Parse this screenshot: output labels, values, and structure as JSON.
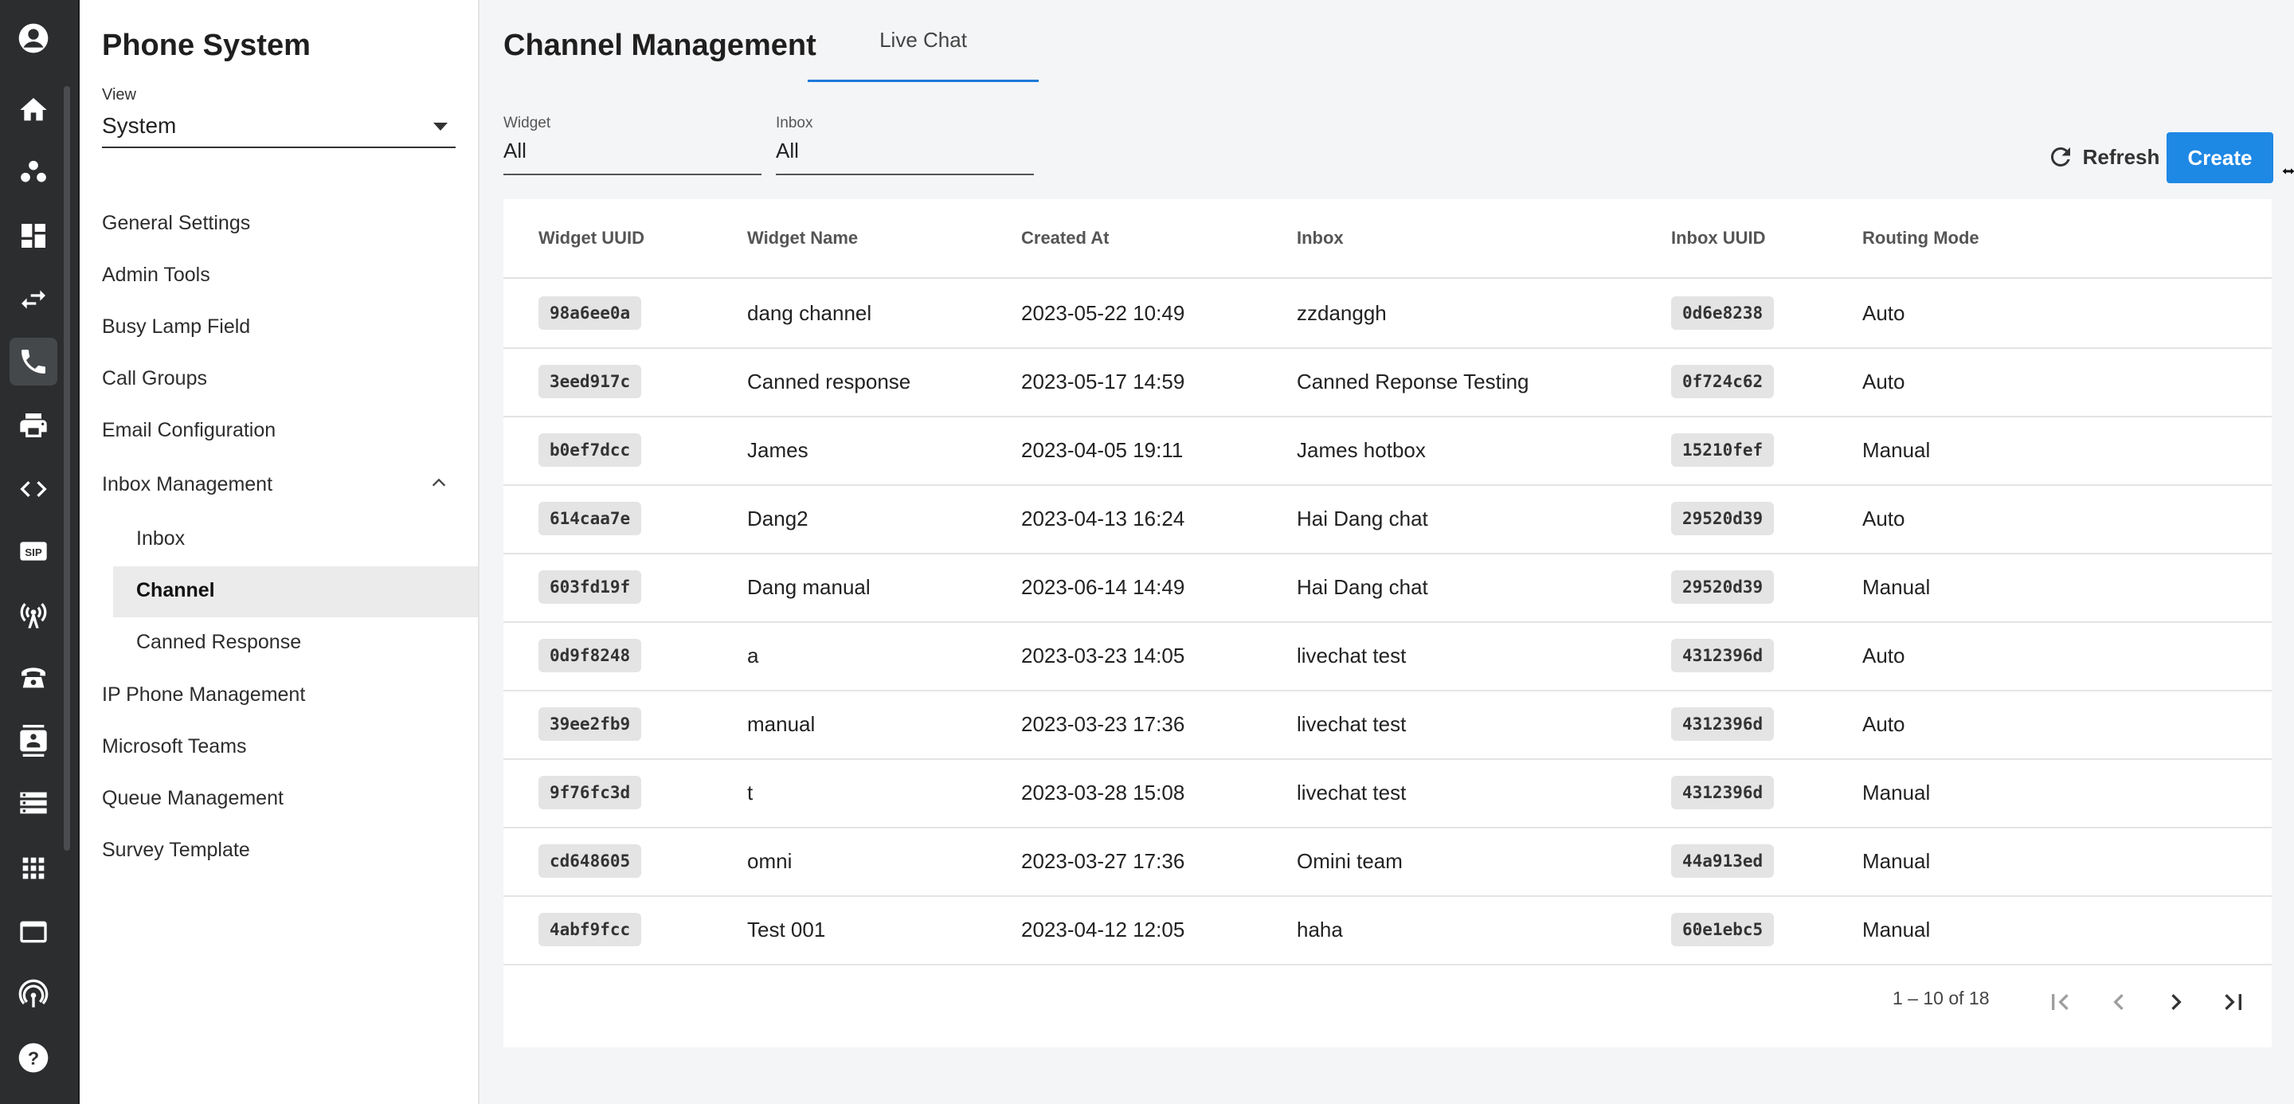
{
  "nav": {
    "title": "Phone System",
    "view_label": "View",
    "view_value": "System",
    "items": [
      {
        "label": "General Settings"
      },
      {
        "label": "Admin Tools"
      },
      {
        "label": "Busy Lamp Field"
      },
      {
        "label": "Call Groups"
      },
      {
        "label": "Email Configuration"
      },
      {
        "label": "Inbox Management",
        "expanded": true
      },
      {
        "label": "IP Phone Management"
      },
      {
        "label": "Microsoft Teams"
      },
      {
        "label": "Queue Management"
      },
      {
        "label": "Survey Template"
      }
    ],
    "sub_items": [
      {
        "label": "Inbox"
      },
      {
        "label": "Channel",
        "active": true
      },
      {
        "label": "Canned Response"
      }
    ]
  },
  "main": {
    "title": "Channel Management",
    "tab_label": "Live Chat",
    "filters": {
      "widget_label": "Widget",
      "widget_value": "All",
      "inbox_label": "Inbox",
      "inbox_value": "All"
    },
    "refresh_label": "Refresh",
    "create_label": "Create"
  },
  "table": {
    "columns": [
      "Widget UUID",
      "Widget Name",
      "Created At",
      "Inbox",
      "Inbox UUID",
      "Routing Mode"
    ],
    "rows": [
      [
        "98a6ee0a",
        "dang channel",
        "2023-05-22 10:49",
        "zzdanggh",
        "0d6e8238",
        "Auto"
      ],
      [
        "3eed917c",
        "Canned response",
        "2023-05-17 14:59",
        "Canned Reponse Testing",
        "0f724c62",
        "Auto"
      ],
      [
        "b0ef7dcc",
        "James",
        "2023-04-05 19:11",
        "James hotbox",
        "15210fef",
        "Manual"
      ],
      [
        "614caa7e",
        "Dang2",
        "2023-04-13 16:24",
        "Hai Dang chat",
        "29520d39",
        "Auto"
      ],
      [
        "603fd19f",
        "Dang manual",
        "2023-06-14 14:49",
        "Hai Dang chat",
        "29520d39",
        "Manual"
      ],
      [
        "0d9f8248",
        "a",
        "2023-03-23 14:05",
        "livechat test",
        "4312396d",
        "Auto"
      ],
      [
        "39ee2fb9",
        "manual",
        "2023-03-23 17:36",
        "livechat test",
        "4312396d",
        "Auto"
      ],
      [
        "9f76fc3d",
        "t",
        "2023-03-28 15:08",
        "livechat test",
        "4312396d",
        "Manual"
      ],
      [
        "cd648605",
        "omni",
        "2023-03-27 17:36",
        "Omini team",
        "44a913ed",
        "Manual"
      ],
      [
        "4abf9fcc",
        "Test 001",
        "2023-04-12 12:05",
        "haha",
        "60e1ebc5",
        "Manual"
      ]
    ],
    "pagination": "1 – 10 of 18"
  },
  "rail_icons": [
    "account-icon",
    "home-icon",
    "group-icon",
    "dashboard-icon",
    "transfer-icon",
    "phone-icon",
    "printer-icon",
    "code-icon",
    "sip-icon",
    "broadcast-icon",
    "desk-phone-icon",
    "contact-icon",
    "server-icon",
    "apps-icon",
    "window-icon",
    "antenna-icon",
    "help-icon"
  ],
  "colors": {
    "accent": "#1e88e5",
    "rail": "#2b2d2f"
  }
}
